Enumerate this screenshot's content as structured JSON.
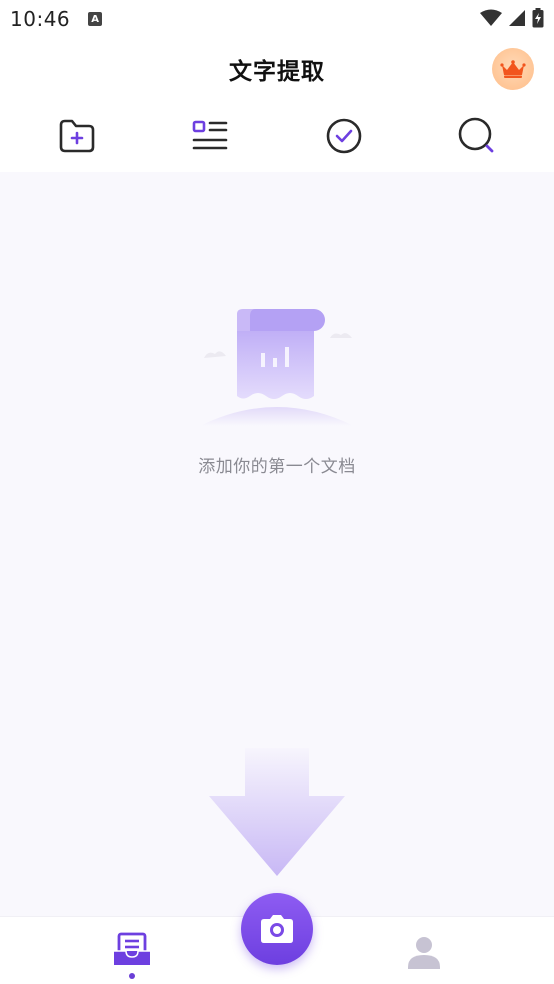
{
  "status_bar": {
    "time": "10:46",
    "notification_icon_letter": "A",
    "icons": [
      "wifi-icon",
      "signal-icon",
      "battery-charging-icon"
    ]
  },
  "header": {
    "title": "文字提取",
    "vip_icon": "crown-icon"
  },
  "toolbar": {
    "items": [
      {
        "icon": "add-folder-icon"
      },
      {
        "icon": "list-view-icon"
      },
      {
        "icon": "check-circle-icon"
      },
      {
        "icon": "search-icon"
      }
    ]
  },
  "empty_state": {
    "message": "添加你的第一个文档",
    "illustration": "document-scroll-illustration"
  },
  "bottom_nav": {
    "items": [
      {
        "icon": "documents-icon",
        "active": true
      },
      {
        "icon": "camera-icon"
      },
      {
        "icon": "profile-icon",
        "active": false
      }
    ]
  },
  "colors": {
    "accent": "#6d3fe0",
    "accent_light": "#c9b9f7",
    "content_bg": "#f9f8fd",
    "text_secondary": "#8a8a92",
    "inactive_icon": "#c7c3d3"
  }
}
